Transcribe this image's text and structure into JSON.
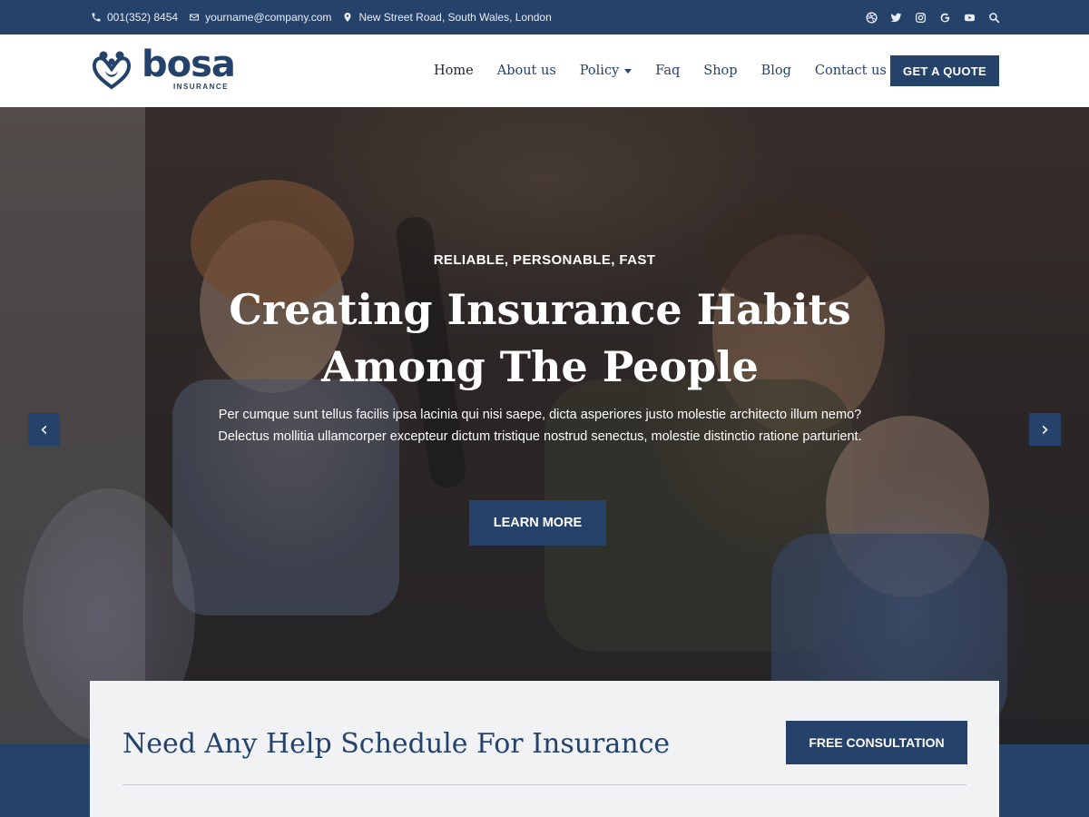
{
  "topbar": {
    "phone": "001(352) 8454",
    "email": "yourname@company.com",
    "address": "New Street Road, South Wales, London",
    "icons": [
      "phone-icon",
      "envelope-icon",
      "location-pin-icon"
    ],
    "social": [
      "dribbble-icon",
      "twitter-icon",
      "instagram-icon",
      "google-icon",
      "youtube-icon",
      "search-icon"
    ]
  },
  "logo": {
    "name": "bosa",
    "tagline": "INSURANCE"
  },
  "nav": {
    "items": [
      {
        "label": "Home",
        "active": true
      },
      {
        "label": "About us"
      },
      {
        "label": "Policy",
        "dropdown": true
      },
      {
        "label": "Faq"
      },
      {
        "label": "Shop"
      },
      {
        "label": "Blog"
      },
      {
        "label": "Contact us"
      }
    ],
    "cta": "GET A QUOTE"
  },
  "hero": {
    "eyebrow": "RELIABLE, PERSONABLE, FAST",
    "title": "Creating Insurance Habits Among The People",
    "text": "Per cumque sunt tellus facilis ipsa lacinia qui nisi saepe, dicta asperiores justo molestie architecto illum nemo? Delectus mollitia ullamcorper excepteur dictum tristique nostrud senectus, molestie distinctio ratione parturient.",
    "button": "LEARN MORE",
    "prev": "‹",
    "next": "›"
  },
  "help": {
    "title": "Need Any Help Schedule For Insurance",
    "button": "FREE CONSULTATION"
  },
  "colors": {
    "primary": "#25426b",
    "card_bg": "#f1f2f4",
    "text_dark": "#1f2430"
  }
}
